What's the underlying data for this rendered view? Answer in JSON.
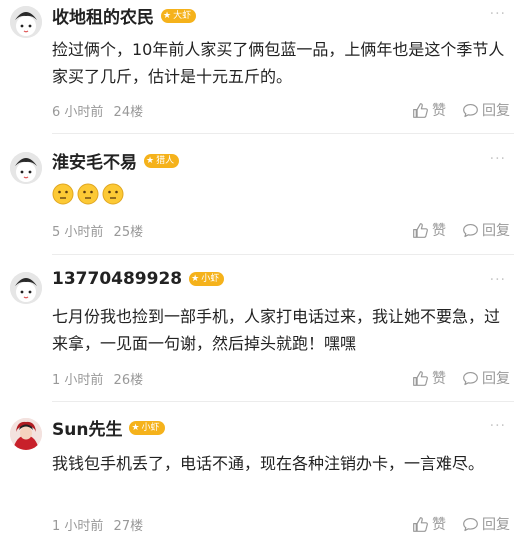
{
  "comments": [
    {
      "name": "收地租的农民",
      "badge": "大虾",
      "text": "捡过俩个，10年前人家买了俩包蓝一品，上俩年也是这个季节人家买了几斤，估计是十元五斤的。",
      "time": "6 小时前",
      "floor": "24楼",
      "like_label": "赞",
      "reply_label": "回复",
      "more": "···"
    },
    {
      "name": "淮安毛不易",
      "badge": "猎人",
      "text": "",
      "emojis": [
        "thinking-face-icon",
        "thinking-face-icon",
        "thinking-face-icon"
      ],
      "time": "5 小时前",
      "floor": "25楼",
      "like_label": "赞",
      "reply_label": "回复",
      "more": "···"
    },
    {
      "name": "13770489928",
      "badge": "小虾",
      "text": "七月份我也捡到一部手机，人家打电话过来，我让她不要急，过来拿，一见面一句谢，然后掉头就跑！嘿嘿",
      "time": "1 小时前",
      "floor": "26楼",
      "like_label": "赞",
      "reply_label": "回复",
      "more": "···"
    },
    {
      "name": "Sun先生",
      "badge": "小虾",
      "text": "我钱包手机丢了，电话不通，现在各种注销办卡，一言难尽。",
      "time": "1 小时前",
      "floor": "27楼",
      "like_label": "赞",
      "reply_label": "回复",
      "more": "···"
    }
  ],
  "colors": {
    "badge": "#f5b21b",
    "meta": "#999999",
    "divider": "#ececec"
  }
}
